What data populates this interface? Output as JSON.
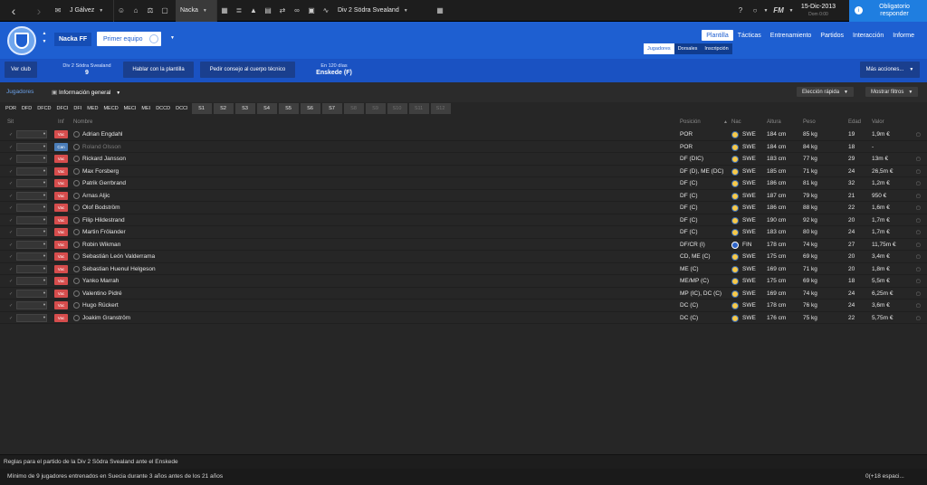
{
  "topbar": {
    "manager": "J Gálvez",
    "club": "Nacka",
    "competition": "Div 2 Södra Svealand",
    "date": "15-Dic-2013",
    "time": "Dom 0:00",
    "fm_label": "FM",
    "obligatorio": "Obligatorio responder"
  },
  "header": {
    "club_name": "Nacka FF",
    "team_selector": "Primer equipo",
    "nav": [
      "Plantilla",
      "Tácticas",
      "Entrenamiento",
      "Partidos",
      "Interacción",
      "Informe"
    ],
    "subnav": [
      "Jugadores",
      "Dorsales",
      "Inscripción"
    ]
  },
  "actionbar": {
    "ver_club": "Ver club",
    "division": "Div 2 Södra Svealand",
    "position": "9",
    "hablar": "Hablar con la plantilla",
    "consejo": "Pedir consejo al cuerpo técnico",
    "next_in": "En 120 días",
    "next_match": "Enskede (F)",
    "mas_acciones": "Más acciones..."
  },
  "toolbar": {
    "crumb": "Jugadores",
    "view": "Información general",
    "eleccion": "Elección rápida",
    "filtros": "Mostrar filtros"
  },
  "filters": {
    "positions": [
      "POR",
      "DFD",
      "DFCD",
      "DFCI",
      "DFI",
      "MED",
      "MECD",
      "MECI",
      "MEI",
      "DCCD",
      "DCCI"
    ],
    "squads": [
      "S1",
      "S2",
      "S3",
      "S4",
      "S5",
      "S6",
      "S7",
      "S8",
      "S9",
      "S10",
      "S11",
      "S12"
    ]
  },
  "columns": {
    "sit": "Sit",
    "inf": "Inf",
    "nombre": "Nombre",
    "posicion": "Posición",
    "nac": "Nac",
    "altura": "Altura",
    "peso": "Peso",
    "edad": "Edad",
    "valor": "Valor"
  },
  "players": [
    {
      "inf": "Vac",
      "name": "Adrian Engdahl",
      "pos": "POR",
      "nac": "SWE",
      "alt": "184 cm",
      "peso": "85 kg",
      "edad": "19",
      "valor": "1,9m €"
    },
    {
      "inf": "Can",
      "name": "Roland Olsson",
      "pos": "POR",
      "nac": "SWE",
      "alt": "184 cm",
      "peso": "84 kg",
      "edad": "18",
      "valor": "-"
    },
    {
      "inf": "Vac",
      "name": "Rickard Jansson",
      "pos": "DF (DIC)",
      "nac": "SWE",
      "alt": "183 cm",
      "peso": "77 kg",
      "edad": "29",
      "valor": "13m €"
    },
    {
      "inf": "Vac",
      "name": "Max Forsberg",
      "pos": "DF (D), ME (DC)",
      "nac": "SWE",
      "alt": "185 cm",
      "peso": "71 kg",
      "edad": "24",
      "valor": "26,5m €"
    },
    {
      "inf": "Vac",
      "name": "Patrik Gerrbrand",
      "pos": "DF (C)",
      "nac": "SWE",
      "alt": "186 cm",
      "peso": "81 kg",
      "edad": "32",
      "valor": "1,2m €"
    },
    {
      "inf": "Vac",
      "name": "Arnas Aljic",
      "pos": "DF (C)",
      "nac": "SWE",
      "alt": "187 cm",
      "peso": "79 kg",
      "edad": "21",
      "valor": "950 €"
    },
    {
      "inf": "Vac",
      "name": "Olof Bodström",
      "pos": "DF (C)",
      "nac": "SWE",
      "alt": "186 cm",
      "peso": "88 kg",
      "edad": "22",
      "valor": "1,6m €"
    },
    {
      "inf": "Vac",
      "name": "Filip Hildestrand",
      "pos": "DF (C)",
      "nac": "SWE",
      "alt": "190 cm",
      "peso": "92 kg",
      "edad": "20",
      "valor": "1,7m €"
    },
    {
      "inf": "Vac",
      "name": "Martin Frölander",
      "pos": "DF (C)",
      "nac": "SWE",
      "alt": "183 cm",
      "peso": "80 kg",
      "edad": "24",
      "valor": "1,7m €"
    },
    {
      "inf": "Vac",
      "name": "Robin Wikman",
      "pos": "DF/CR (I)",
      "nac": "FIN",
      "alt": "178 cm",
      "peso": "74 kg",
      "edad": "27",
      "valor": "11,75m €"
    },
    {
      "inf": "Vac",
      "name": "Sebastián León Valderrama",
      "pos": "CD, ME (C)",
      "nac": "SWE",
      "alt": "175 cm",
      "peso": "69 kg",
      "edad": "20",
      "valor": "3,4m €"
    },
    {
      "inf": "Vac",
      "name": "Sebastian Huenul Helgeson",
      "pos": "ME (C)",
      "nac": "SWE",
      "alt": "169 cm",
      "peso": "71 kg",
      "edad": "20",
      "valor": "1,8m €"
    },
    {
      "inf": "Vac",
      "name": "Yanko Marrah",
      "pos": "ME/MP (C)",
      "nac": "SWE",
      "alt": "175 cm",
      "peso": "69 kg",
      "edad": "18",
      "valor": "5,5m €"
    },
    {
      "inf": "Vac",
      "name": "Valentino Pidré",
      "pos": "MP (IC), DC (C)",
      "nac": "SWE",
      "alt": "169 cm",
      "peso": "74 kg",
      "edad": "24",
      "valor": "6,25m €"
    },
    {
      "inf": "Vac",
      "name": "Hugo Rückert",
      "pos": "DC (C)",
      "nac": "SWE",
      "alt": "178 cm",
      "peso": "76 kg",
      "edad": "24",
      "valor": "3,6m €"
    },
    {
      "inf": "Vac",
      "name": "Joakim Granström",
      "pos": "DC (C)",
      "nac": "SWE",
      "alt": "176 cm",
      "peso": "75 kg",
      "edad": "22",
      "valor": "5,75m €"
    }
  ],
  "footer": {
    "rules_title": "Reglas para el partido de la Div 2 Södra Svealand ante el Enskede",
    "rule": "Mínimo de 9 jugadores entrenados en Suecia durante 3 años antes de los 21 años",
    "count": "0(+18 espaci..."
  }
}
